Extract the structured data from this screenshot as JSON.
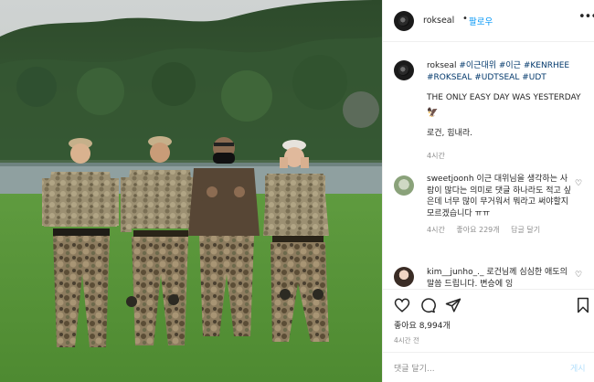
{
  "header": {
    "username": "rokseal",
    "separator": "•",
    "follow_label": "팔로우",
    "more_label": "•••"
  },
  "caption": {
    "username": "rokseal",
    "hashtags": "#이근대위 #이근 #KENRHEE #ROKSEAL #UDTSEAL #UDT",
    "line1": "THE ONLY EASY DAY WAS YESTERDAY",
    "emoji": "🦅",
    "line2": "로건, 힘내라.",
    "time": "4시간"
  },
  "comments": [
    {
      "username": "sweetjoonh",
      "text": "이근 대위님을 생각하는 사람이 많다는 의미로 댓글 하나라도 적고 싶은데 너무 많이 무거워서 뭐라고 써야할지 모르겠습니다 ㅠㅠ",
      "time": "4시간",
      "likes": "좋아요 229개",
      "reply": "답글 달기"
    },
    {
      "username": "kim__junho_._",
      "text": "로건님께 심심한 애도의 말씀 드립니다. 변승에 잉"
    }
  ],
  "actions": {
    "likes": "좋아요 8,994개",
    "time": "4시간 전"
  },
  "add_comment": {
    "placeholder": "댓글 달기...",
    "post_label": "게시"
  },
  "icons": [
    "heart-icon",
    "comment-icon",
    "share-icon",
    "bookmark-icon",
    "more-icon"
  ],
  "colors": {
    "link_blue": "#0095f6",
    "hashtag_blue": "#00376b",
    "muted_gray": "#8e8e8e",
    "post_button_disabled": "#b2dffc"
  }
}
